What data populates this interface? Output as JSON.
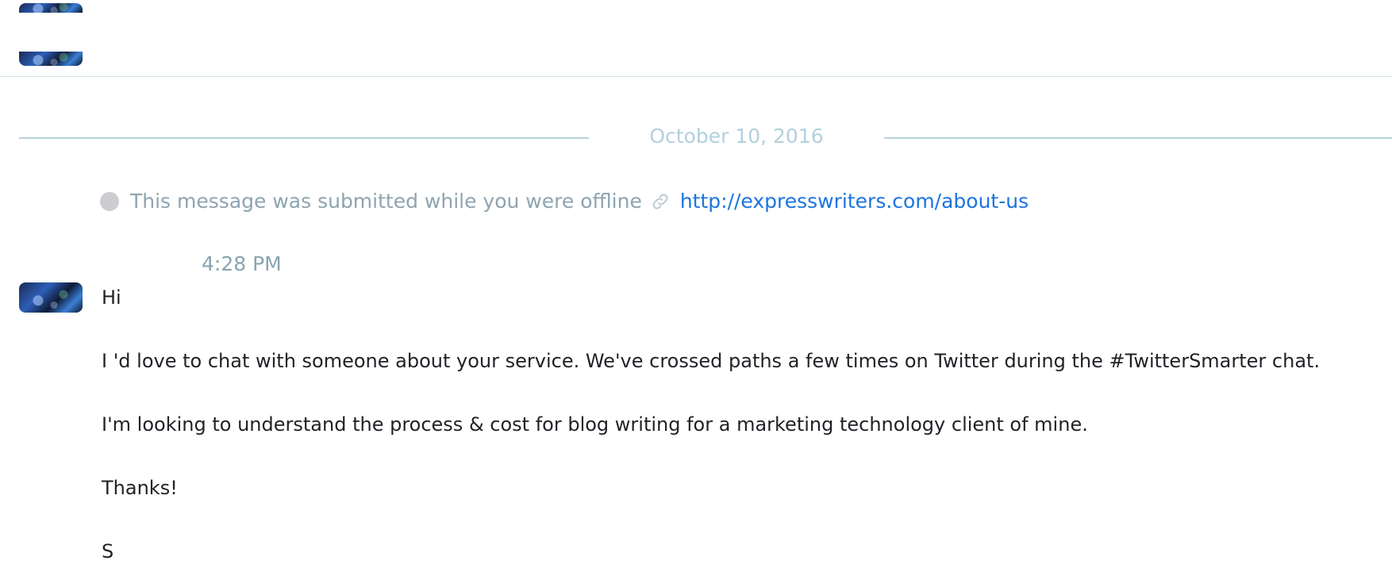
{
  "date_separator": "October 10, 2016",
  "offline_notice": {
    "text": "This message was submitted while you were offline",
    "link_icon": "link-icon",
    "url": "http://expresswriters.com/about-us"
  },
  "message": {
    "time": "4:28 PM",
    "lines": [
      "Hi",
      "I 'd love to chat with someone about your service. We've crossed paths a few times on Twitter during the #TwitterSmarter chat.",
      "I'm looking to understand the process & cost for blog writing for a marketing technology client of mine.",
      "Thanks!",
      "S"
    ]
  },
  "colors": {
    "link": "#1b74e0",
    "muted_text": "#8ea4b0",
    "date_label": "#b3d0dd",
    "divider": "#b7d3dc",
    "offline_dot": "#cbcdd1"
  }
}
